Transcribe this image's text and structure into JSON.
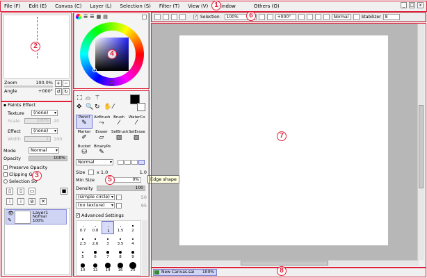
{
  "menu": {
    "items": [
      "File (F)",
      "Edit (E)",
      "Canvas (C)",
      "Layer (L)",
      "Selection (S)",
      "Filter (T)",
      "View (V)",
      "Window",
      "Others (O)"
    ],
    "win_min": "_",
    "win_max": "□",
    "win_close": "x"
  },
  "markers": [
    "1",
    "2",
    "3",
    "4",
    "5",
    "6",
    "7",
    "8"
  ],
  "navigator": {
    "zoom_label": "Zoom",
    "zoom_value": "100.0%",
    "angle_label": "Angle",
    "angle_value": "+000°"
  },
  "paints_effect": {
    "title": "Paints Effect",
    "texture_label": "Texture",
    "texture_value": "(none)",
    "scale_label": "Scale",
    "scale_value": "100%",
    "scale_num": "20",
    "effect_label": "Effect",
    "effect_value": "(none)",
    "width_label": "Width",
    "width_value": "1",
    "width_num": "100"
  },
  "layer_props": {
    "mode_label": "Mode",
    "mode_value": "Normal",
    "opacity_label": "Opacity",
    "opacity_value": "100%",
    "preserve_opacity": "Preserve Opacity",
    "clipping_group": "Clipping Gr",
    "selection_source": "Selection So"
  },
  "layer": {
    "name": "Layer1",
    "mode": "Normal",
    "opacity": "100%"
  },
  "tools": [
    {
      "label": "Pencil",
      "glyph": "✎",
      "selected": true
    },
    {
      "label": "AirBrush",
      "glyph": "⤳",
      "selected": false
    },
    {
      "label": "Brush",
      "glyph": "⁄",
      "selected": false
    },
    {
      "label": "WaterCo",
      "glyph": "⁄",
      "selected": false
    },
    {
      "label": "Marker",
      "glyph": "✐",
      "selected": false
    },
    {
      "label": "Eraser",
      "glyph": "▱",
      "selected": false
    },
    {
      "label": "SelBrush",
      "glyph": "▨",
      "selected": false
    },
    {
      "label": "SelErase",
      "glyph": "▧",
      "selected": false
    },
    {
      "label": "Bucket",
      "glyph": "⛁",
      "selected": false
    },
    {
      "label": "BinaryPe",
      "glyph": "✎",
      "selected": false
    }
  ],
  "brush": {
    "blend_mode": "Normal",
    "size_label": "Size",
    "size_mult": "x 1.0",
    "size_value": "1.0",
    "min_size_label": "Min Size",
    "min_size_value": "0%",
    "density_label": "Density",
    "density_value": "100",
    "shape_value": "(simple circle)",
    "shape_num": "50",
    "texture_value": "(no texture)",
    "texture_num": "95",
    "advanced_label": "Advanced Settings",
    "tooltip": "Edge shape"
  },
  "brush_sizes": [
    "0.7",
    "0.8",
    "1",
    "1.5",
    "2",
    "2.3",
    "2.6",
    "3",
    "3.5",
    "4",
    "5",
    "6",
    "7",
    "8",
    "9",
    "10",
    "12",
    "14",
    "16",
    "20"
  ],
  "selected_size": "1",
  "canvas_toolbar": {
    "selection_label": "Selection",
    "zoom": "100%",
    "angle": "+000°",
    "mode": "Normal",
    "stabilizer_label": "Stabilizer",
    "stabilizer_value": "8"
  },
  "status": {
    "tab_name": "New Canvas.sai",
    "tab_zoom": "100%"
  },
  "colors": {
    "annotation": "#e0203a",
    "selected_tool": "#d8dcf8",
    "canvas_bg": "#b7b7b7",
    "layer_selected": "#d0d4f4"
  }
}
